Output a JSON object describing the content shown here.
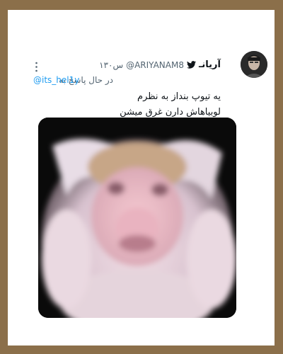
{
  "tweet": {
    "display_name": "آریانـ",
    "handle": "@ARIYANAM8",
    "timestamp": "۱۳۰س",
    "reply_prefix": "در حال پاسخ به",
    "reply_to": "@its_hel1y",
    "text_lines": [
      "یه تیوپ بنداز به نظرم",
      "لوبیاهاش دارن غرق میشن"
    ],
    "verified_icon": "twitter-bird-icon",
    "more_icon": "vertical-ellipsis-icon"
  },
  "colors": {
    "frame_background": "#8b6f4a",
    "card_background": "#ffffff",
    "text_primary": "#0f1419",
    "text_secondary": "#536471",
    "accent": "#1d9bf0"
  }
}
